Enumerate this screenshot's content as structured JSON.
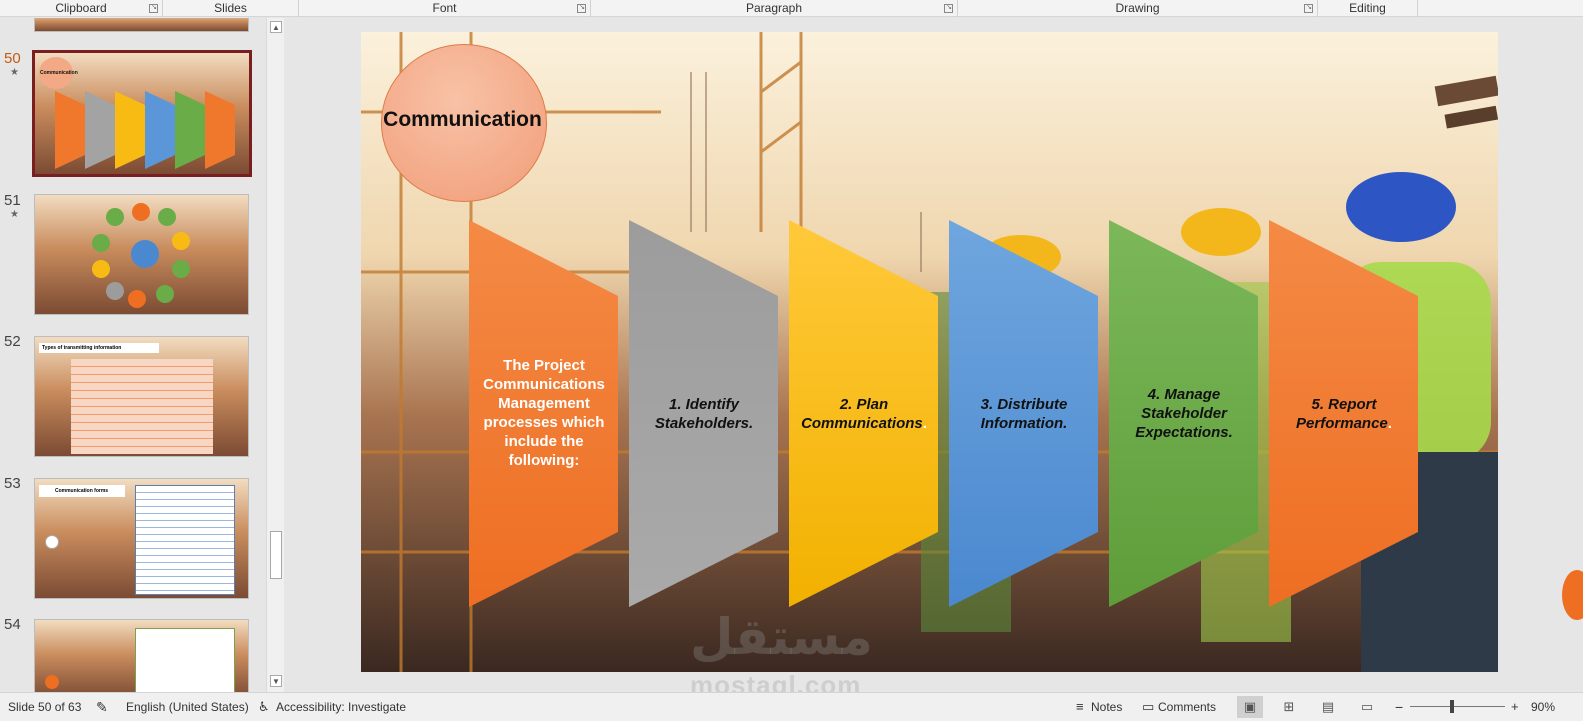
{
  "ribbon": {
    "groups": [
      "Clipboard",
      "Slides",
      "Font",
      "Paragraph",
      "Drawing",
      "Editing"
    ]
  },
  "thumbnails": [
    {
      "number": "50",
      "starred": true,
      "selected": true,
      "caption": "Communication"
    },
    {
      "number": "51",
      "starred": true,
      "selected": false,
      "caption": ""
    },
    {
      "number": "52",
      "starred": false,
      "selected": false,
      "caption": "Types of transmitting information"
    },
    {
      "number": "53",
      "starred": false,
      "selected": false,
      "caption": "Communication forms"
    },
    {
      "number": "54",
      "starred": false,
      "selected": false,
      "caption": ""
    }
  ],
  "star_glyph": "★",
  "slide": {
    "title": "Communication",
    "panels": [
      {
        "text": "The Project Communications Management processes which include the following:",
        "color_top": "#f48a45",
        "color_bottom": "#ee6e22",
        "text_color": "#ffffff",
        "italic": false
      },
      {
        "text": "1. Identify Stakeholders.",
        "color_top": "#9c9c9c",
        "color_bottom": "#a9a9a9",
        "text_color": "#111111",
        "italic": true
      },
      {
        "text": "2. Plan Communications",
        "trail": ".",
        "color_top": "#ffc62a",
        "color_bottom": "#f2b100",
        "text_color": "#111111",
        "italic": true
      },
      {
        "text": "3. Distribute Information.",
        "color_top": "#6ea4dc",
        "color_bottom": "#4a88cf",
        "text_color": "#111111",
        "italic": true
      },
      {
        "text": "4. Manage Stakeholder Expectations.",
        "color_top": "#7cb85a",
        "color_bottom": "#5e9d3a",
        "text_color": "#111111",
        "italic": true
      },
      {
        "text": "5. Report Performance",
        "trail": ".",
        "color_top": "#f48a45",
        "color_bottom": "#ee6e22",
        "text_color": "#111111",
        "italic": true
      }
    ]
  },
  "statusbar": {
    "slide_info": "Slide 50 of 63",
    "language": "English (United States)",
    "accessibility": "Accessibility: Investigate",
    "notes": "Notes",
    "comments": "Comments",
    "zoom_minus": "−",
    "zoom_plus": "+",
    "zoom": "90%"
  },
  "watermark": {
    "line1": "مستقل",
    "line2": "mostaql.com"
  }
}
